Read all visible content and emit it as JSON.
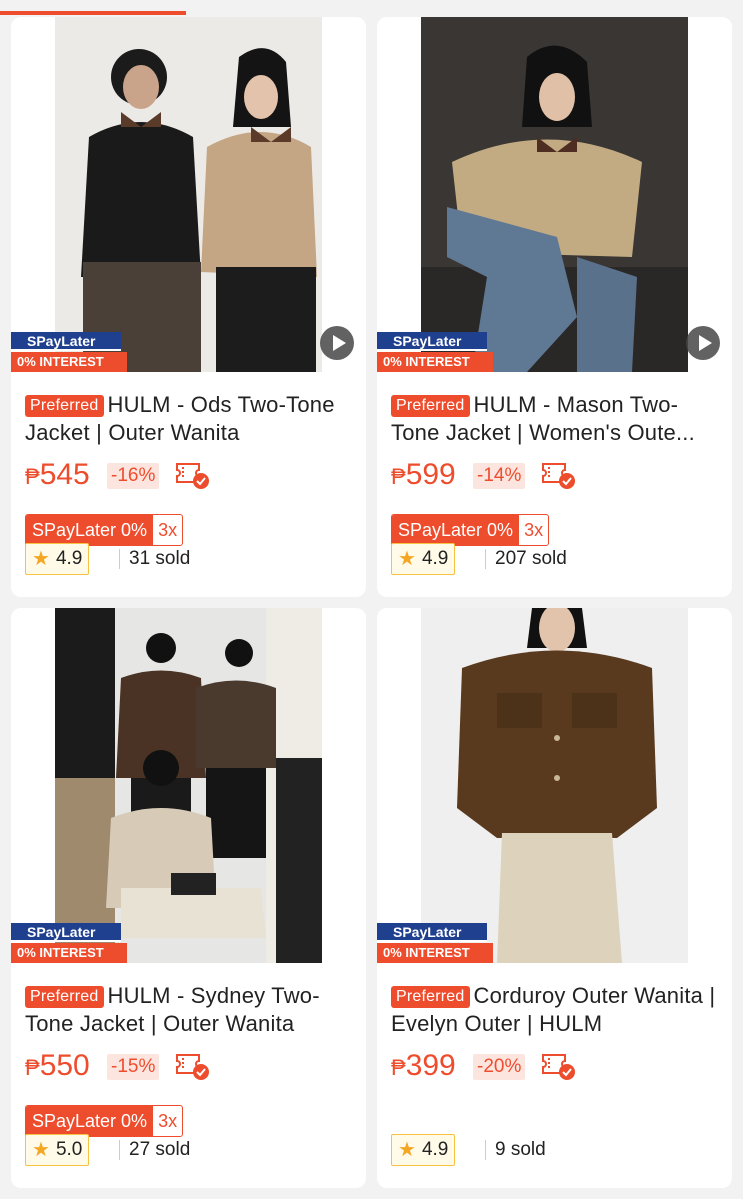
{
  "progress": {
    "fraction": 0.25
  },
  "products": [
    {
      "preferred_label": "Preferred",
      "title": "HULM - Ods Two-Tone Jacket | Outer Wanita",
      "currency": "₱",
      "price": "545",
      "discount": "-16%",
      "spaylater_label": "SPayLater 0%",
      "installments": "3x",
      "rating": "4.9",
      "sold": "31 sold",
      "badge_top": "SPayLater",
      "badge_bottom": "0% INTEREST",
      "has_video": true
    },
    {
      "preferred_label": "Preferred",
      "title": "HULM - Mason Two-Tone Jacket | Women's Oute...",
      "currency": "₱",
      "price": "599",
      "discount": "-14%",
      "spaylater_label": "SPayLater 0%",
      "installments": "3x",
      "rating": "4.9",
      "sold": "207 sold",
      "badge_top": "SPayLater",
      "badge_bottom": "0% INTEREST",
      "has_video": true
    },
    {
      "preferred_label": "Preferred",
      "title": "HULM - Sydney Two-Tone Jacket | Outer Wanita",
      "currency": "₱",
      "price": "550",
      "discount": "-15%",
      "spaylater_label": "SPayLater 0%",
      "installments": "3x",
      "rating": "5.0",
      "sold": "27 sold",
      "badge_top": "SPayLater",
      "badge_bottom": "0% INTEREST",
      "has_video": false
    },
    {
      "preferred_label": "Preferred",
      "title": "Corduroy Outer Wanita | Evelyn Outer | HULM",
      "currency": "₱",
      "price": "399",
      "discount": "-20%",
      "spaylater_label": "",
      "installments": "",
      "rating": "4.9",
      "sold": "9 sold",
      "badge_top": "SPayLater",
      "badge_bottom": "0% INTEREST",
      "has_video": false
    }
  ],
  "colors": {
    "accent": "#ee4d2d",
    "badge_blue": "#1f3f8f",
    "star": "#f5a623"
  },
  "icons": [
    "play-icon",
    "free-shipping-voucher-icon",
    "star-icon"
  ]
}
